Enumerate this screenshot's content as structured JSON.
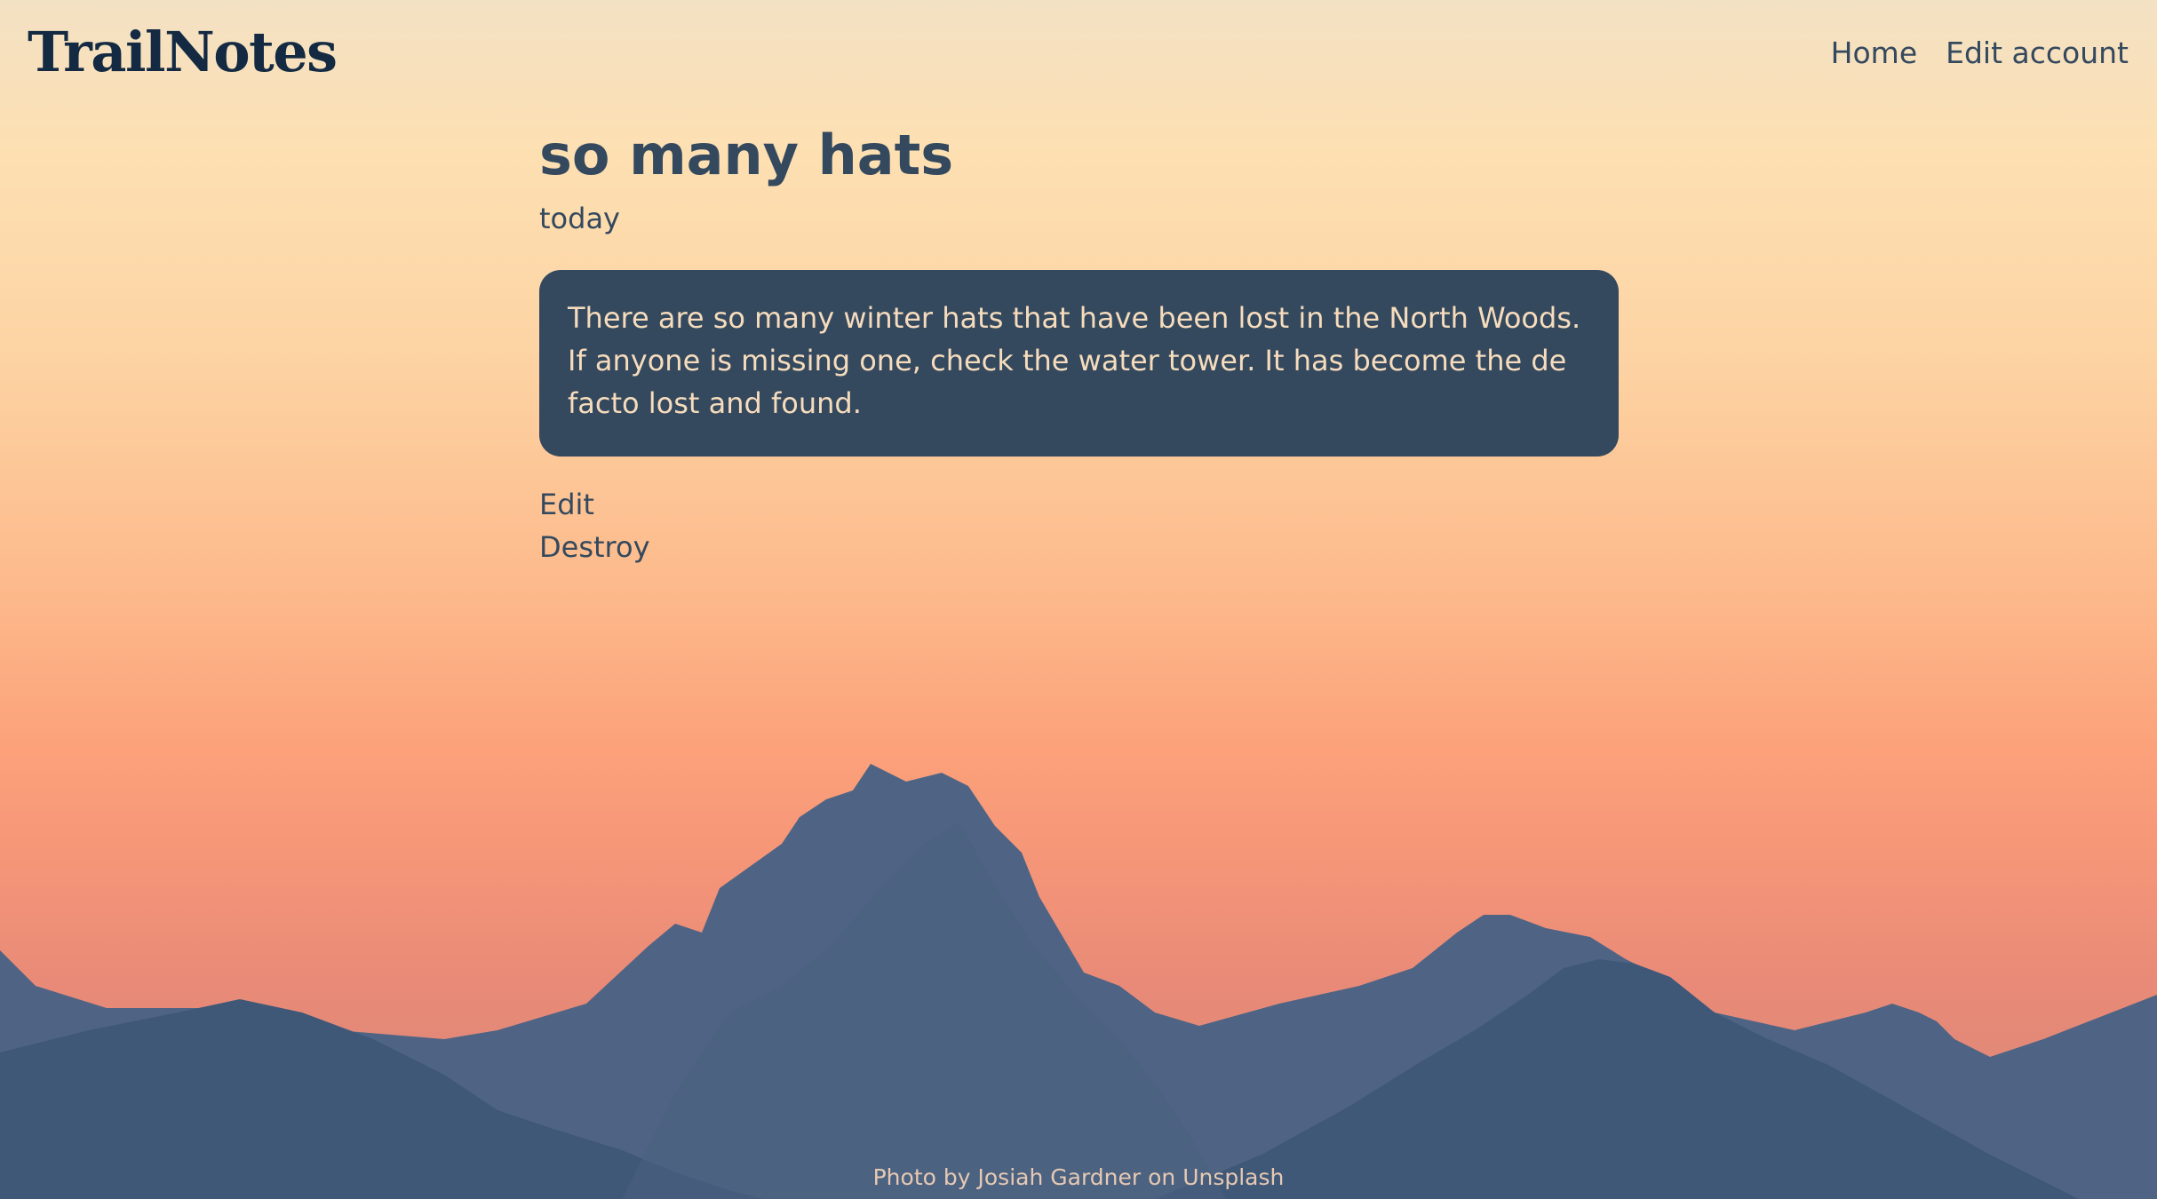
{
  "header": {
    "brand": "TrailNotes",
    "nav": {
      "home": "Home",
      "edit_account": "Edit account"
    }
  },
  "post": {
    "title": "so many hats",
    "date": "today",
    "body": "There are so many winter hats that have been lost in the North Woods. If anyone is missing one, check the water tower. It has become the de facto lost and found.",
    "actions": {
      "edit": "Edit",
      "destroy": "Destroy"
    }
  },
  "footer": {
    "credit_prefix": "Photo by",
    "photographer": "Josiah Gardner",
    "credit_middle": "on",
    "source": "Unsplash"
  },
  "colors": {
    "brand": "#132a42",
    "text": "#34495e",
    "card_background": "#34495e",
    "card_text": "#f6dcbd",
    "mountain_far": "#4f6484",
    "mountain_near": "#3f5878"
  }
}
